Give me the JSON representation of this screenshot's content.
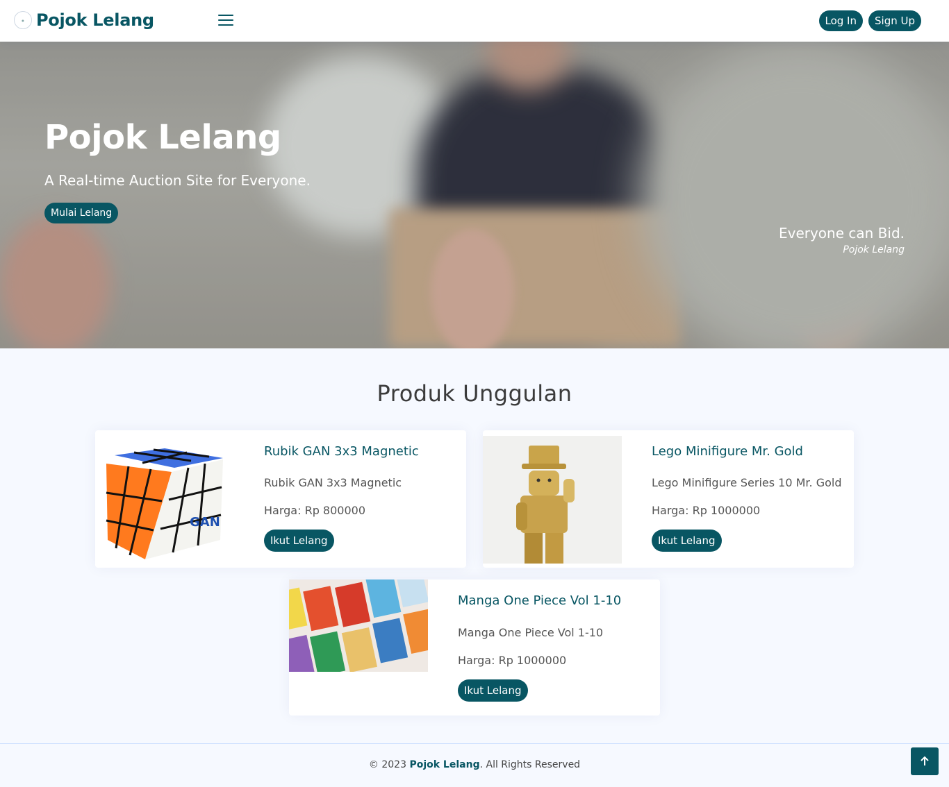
{
  "header": {
    "brand": "Pojok Lelang",
    "login_label": "Log In",
    "signup_label": "Sign Up"
  },
  "hero": {
    "title": "Pojok Lelang",
    "subtitle": "A Real-time Auction Site for Everyone.",
    "cta_label": "Mulai Lelang",
    "quote_text": "Everyone can Bid.",
    "quote_author": "Pojok Lelang"
  },
  "products": {
    "title": "Produk Unggulan",
    "items": [
      {
        "name": "Rubik GAN 3x3 Magnetic",
        "description": "Rubik GAN 3x3 Magnetic",
        "price": "Harga: Rp 800000",
        "button": "Ikut Lelang"
      },
      {
        "name": "Lego Minifigure Mr. Gold",
        "description": "Lego Minifigure Series 10 Mr. Gold",
        "price": "Harga: Rp 1000000",
        "button": "Ikut Lelang"
      },
      {
        "name": "Manga One Piece Vol 1-10",
        "description": "Manga One Piece Vol 1-10",
        "price": "Harga: Rp 1000000",
        "button": "Ikut Lelang"
      }
    ]
  },
  "footer": {
    "prefix": "© 2023 ",
    "brand": "Pojok Lelang",
    "suffix": ". All Rights Reserved"
  },
  "colors": {
    "primary": "#085663",
    "background": "#f6f9ff"
  }
}
